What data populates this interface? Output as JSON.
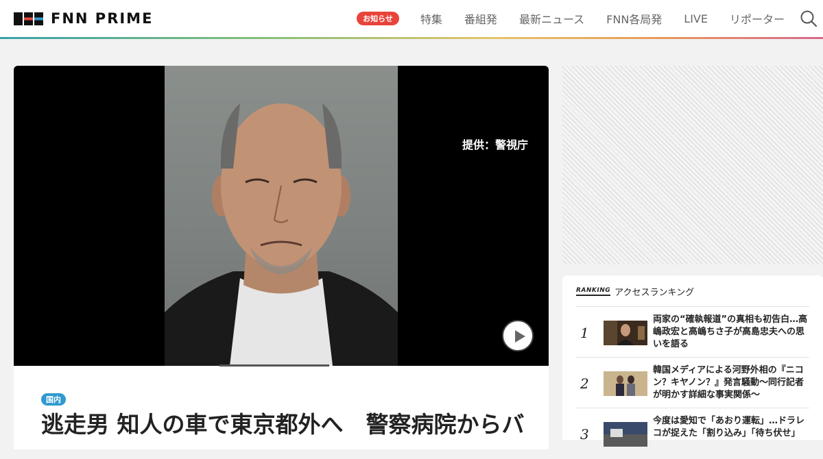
{
  "header": {
    "logo": "FNN PRIME",
    "notice_label": "お知らせ",
    "nav": [
      "特集",
      "番組発",
      "最新ニュース",
      "FNN各局発",
      "LIVE",
      "リポーター"
    ]
  },
  "article": {
    "credit": "提供：警視庁",
    "category": "国内",
    "headline": "逃走男 知人の車で東京都外へ　警察病院からバ"
  },
  "ranking": {
    "label": "RANKING",
    "title": "アクセスランキング",
    "items": [
      {
        "rank": "1",
        "text": "両家の“確執報道”の真相も初告白…高嶋政宏と高嶋ちさ子が高島忠夫への思いを語る"
      },
      {
        "rank": "2",
        "text": "韓国メディアによる河野外相の『ニコン？キヤノン？』発言騒動～同行記者が明かす詳細な事実関係～"
      },
      {
        "rank": "3",
        "text": "今度は愛知で「あおり運転」…ドラレコが捉えた「割り込み」「待ち伏せ」"
      }
    ]
  },
  "colors": {
    "accent_red": "#e8443a",
    "accent_blue": "#2f9ad0"
  }
}
